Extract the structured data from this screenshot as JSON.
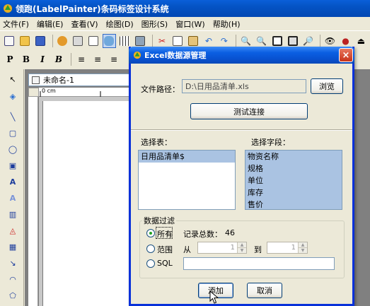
{
  "app": {
    "title": "领跑(LabelPainter)条码标签设计系统",
    "menu": [
      "文件(F)",
      "编辑(E)",
      "查看(V)",
      "绘图(D)",
      "图形(S)",
      "窗口(W)",
      "帮助(H)"
    ],
    "doc_tab": "未命名-1",
    "ruler_label": "0 cm"
  },
  "format_toolbar": {
    "p": "P",
    "b": "B",
    "i": "I",
    "b2": "B"
  },
  "dialog": {
    "title": "Excel数据源管理",
    "close_symbol": "×",
    "file_path_label": "文件路径：",
    "file_path_value": "D:\\日用品清单.xls",
    "browse_button": "浏览",
    "test_button": "测试连接",
    "select_table_label": "选择表：",
    "tables": [
      "日用品清单$"
    ],
    "select_fields_label": "选择字段：",
    "fields": [
      "物资名称",
      "规格",
      "单位",
      "库存",
      "售价"
    ],
    "filter": {
      "title": "数据过滤",
      "all_label": "所有",
      "record_count_label": "记录总数：",
      "record_count": "46",
      "range_label": "范围",
      "from_label": "从",
      "from_value": "1",
      "to_label": "到",
      "to_value": "1",
      "sql_label": "SQL",
      "sql_value": ""
    },
    "add_button": "添加",
    "cancel_button": "取消"
  },
  "colors": {
    "titlebar": "#0453c4",
    "dialog_border": "#0831d9",
    "selection": "#aac3e2",
    "close": "#c8321a"
  }
}
